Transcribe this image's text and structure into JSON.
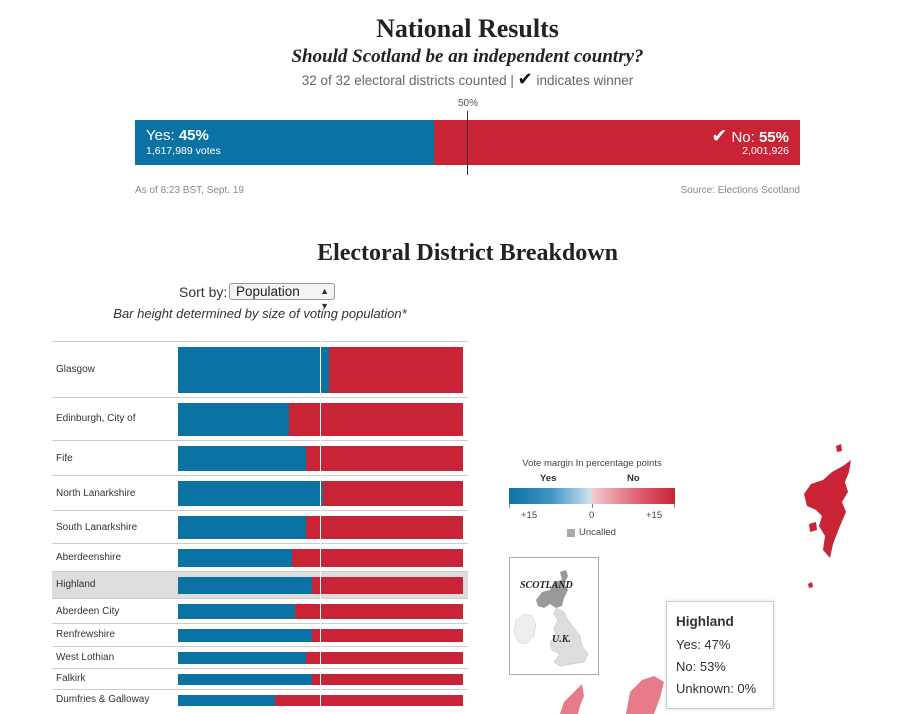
{
  "national": {
    "title": "National Results",
    "subtitle": "Should Scotland be an independent country?",
    "status_counted": "32 of 32 electoral districts counted |",
    "status_check": "✔",
    "status_winner": "indicates winner",
    "midpoint_label": "50%",
    "yes_label": "Yes:",
    "yes_pct_label": "45%",
    "yes_votes": "1,617,989 votes",
    "no_check": "✔",
    "no_label": "No:",
    "no_pct_label": "55%",
    "no_votes": "2,001,926",
    "as_of": "As of 8:23 BST, Sept. 19",
    "source": "Source: Elections Scotland"
  },
  "breakdown": {
    "title": "Electoral District Breakdown",
    "sort_label": "Sort by:",
    "sort_value": "Population",
    "note": "Bar height determined by size of voting population*",
    "highlighted": "Highland"
  },
  "legend": {
    "title": "Vote margin In percentage points",
    "yes": "Yes",
    "no": "No",
    "tick_left": "+15",
    "tick_mid": "0",
    "tick_right": "+15",
    "uncalled": "Uncalled"
  },
  "inset": {
    "scotland": "SCOTLAND",
    "uk": "U.K."
  },
  "tooltip": {
    "name": "Highland",
    "yes": "Yes: 47%",
    "no": "No: 53%",
    "unknown": "Unknown: 0%"
  },
  "colors": {
    "yes": "#0b73a4",
    "no": "#c92336",
    "uncalled": "#aaaaaa"
  },
  "chart_data": [
    {
      "type": "bar",
      "orientation": "horizontal",
      "stacked": true,
      "categories": [
        "National"
      ],
      "series": [
        {
          "name": "Yes",
          "values": [
            45
          ]
        },
        {
          "name": "No",
          "values": [
            55
          ]
        }
      ],
      "votes": {
        "yes": 1617989,
        "no": 2001926
      },
      "xlim": [
        0,
        100
      ]
    },
    {
      "type": "bar",
      "orientation": "horizontal",
      "stacked": true,
      "categories": [
        "Glasgow",
        "Edinburgh, City of",
        "Fife",
        "North Lanarkshire",
        "South Lanarkshire",
        "Aberdeenshire",
        "Highland",
        "Aberdeen City",
        "Renfrewshire",
        "West Lothian",
        "Falkirk",
        "Dumfries & Galloway"
      ],
      "series": [
        {
          "name": "Yes",
          "values": [
            53,
            39,
            45,
            51,
            45,
            40,
            47,
            41,
            47,
            45,
            47,
            34
          ]
        },
        {
          "name": "No",
          "values": [
            47,
            61,
            55,
            49,
            55,
            60,
            53,
            59,
            53,
            55,
            53,
            66
          ]
        }
      ],
      "bar_height_basis": "voting population",
      "relative_population": [
        41,
        30,
        23,
        22,
        21,
        16,
        15,
        14,
        11,
        11,
        10,
        10
      ],
      "xlim": [
        0,
        100
      ]
    }
  ]
}
